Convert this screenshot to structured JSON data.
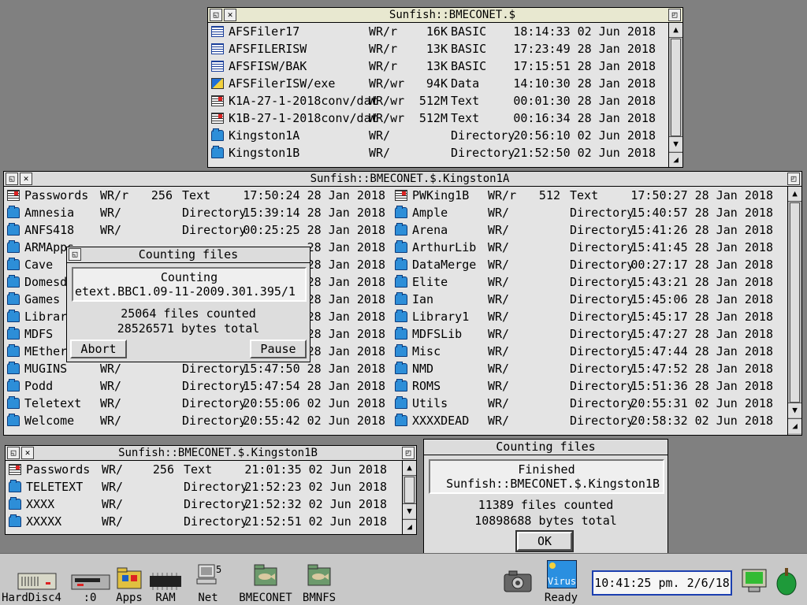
{
  "window_top": {
    "title": "Sunfish::BMECONET.$",
    "rows": [
      {
        "icon": "basic-file-icon",
        "name": "AFSFiler17",
        "access": "WR/r",
        "size": "16K",
        "type": "BASIC",
        "time": "18:14:33 02 Jun 2018"
      },
      {
        "icon": "basic-file-icon",
        "name": "AFSFILERISW",
        "access": "WR/r",
        "size": "13K",
        "type": "BASIC",
        "time": "17:23:49 28 Jan 2018"
      },
      {
        "icon": "basic-file-icon",
        "name": "AFSFISW/BAK",
        "access": "WR/r",
        "size": "13K",
        "type": "BASIC",
        "time": "17:15:51 28 Jan 2018"
      },
      {
        "icon": "data-file-icon",
        "name": "AFSFilerISW/exe",
        "access": "WR/wr",
        "size": "94K",
        "type": "Data",
        "time": "14:10:30 28 Jan 2018"
      },
      {
        "icon": "text-file-icon",
        "name": "K1A-27-1-2018conv/dat",
        "access": "WR/wr",
        "size": "512M",
        "type": "Text",
        "time": "00:01:30 28 Jan 2018"
      },
      {
        "icon": "text-file-icon",
        "name": "K1B-27-1-2018conv/dat",
        "access": "WR/wr",
        "size": "512M",
        "type": "Text",
        "time": "00:16:34 28 Jan 2018"
      },
      {
        "icon": "directory-icon",
        "name": "Kingston1A",
        "access": "WR/",
        "size": "",
        "type": "Directory",
        "time": "20:56:10 02 Jun 2018"
      },
      {
        "icon": "directory-icon",
        "name": "Kingston1B",
        "access": "WR/",
        "size": "",
        "type": "Directory",
        "time": "21:52:50 02 Jun 2018"
      }
    ]
  },
  "window_middle": {
    "title": "Sunfish::BMECONET.$.Kingston1A",
    "left_rows": [
      {
        "icon": "text-file-icon",
        "name": "Passwords",
        "access": "WR/r",
        "size": "256",
        "type": "Text",
        "time": "17:50:24 28 Jan 2018"
      },
      {
        "icon": "directory-icon",
        "name": "Amnesia",
        "access": "WR/",
        "size": "",
        "type": "Directory",
        "time": "15:39:14 28 Jan 2018"
      },
      {
        "icon": "directory-icon",
        "name": "ANFS418",
        "access": "WR/",
        "size": "",
        "type": "Directory",
        "time": "00:25:25 28 Jan 2018"
      },
      {
        "icon": "directory-icon",
        "name": "ARMApps",
        "access": "",
        "size": "",
        "type": "",
        "time": "28 Jan 2018"
      },
      {
        "icon": "directory-icon",
        "name": "Cave",
        "access": "",
        "size": "",
        "type": "",
        "time": "28 Jan 2018"
      },
      {
        "icon": "directory-icon",
        "name": "Domesda",
        "access": "",
        "size": "",
        "type": "",
        "time": "28 Jan 2018"
      },
      {
        "icon": "directory-icon",
        "name": "Games",
        "access": "",
        "size": "",
        "type": "",
        "time": "28 Jan 2018"
      },
      {
        "icon": "directory-icon",
        "name": "Library",
        "access": "",
        "size": "",
        "type": "",
        "time": "28 Jan 2018"
      },
      {
        "icon": "directory-icon",
        "name": "MDFS",
        "access": "",
        "size": "",
        "type": "",
        "time": "28 Jan 2018"
      },
      {
        "icon": "directory-icon",
        "name": "MEthern",
        "access": "",
        "size": "",
        "type": "",
        "time": "28 Jan 2018"
      },
      {
        "icon": "directory-icon",
        "name": "MUGINS",
        "access": "WR/",
        "size": "",
        "type": "Directory",
        "time": "15:47:50 28 Jan 2018"
      },
      {
        "icon": "directory-icon",
        "name": "Podd",
        "access": "WR/",
        "size": "",
        "type": "Directory",
        "time": "15:47:54 28 Jan 2018"
      },
      {
        "icon": "directory-icon",
        "name": "Teletext",
        "access": "WR/",
        "size": "",
        "type": "Directory",
        "time": "20:55:06 02 Jun 2018"
      },
      {
        "icon": "directory-icon",
        "name": "Welcome",
        "access": "WR/",
        "size": "",
        "type": "Directory",
        "time": "20:55:42 02 Jun 2018"
      }
    ],
    "right_rows": [
      {
        "icon": "text-file-icon",
        "name": "PWKing1B",
        "access": "WR/r",
        "size": "512",
        "type": "Text",
        "time": "17:50:27 28 Jan 2018"
      },
      {
        "icon": "directory-icon",
        "name": "Ample",
        "access": "WR/",
        "size": "",
        "type": "Directory",
        "time": "15:40:57 28 Jan 2018"
      },
      {
        "icon": "directory-icon",
        "name": "Arena",
        "access": "WR/",
        "size": "",
        "type": "Directory",
        "time": "15:41:26 28 Jan 2018"
      },
      {
        "icon": "directory-icon",
        "name": "ArthurLib",
        "access": "WR/",
        "size": "",
        "type": "Directory",
        "time": "15:41:45 28 Jan 2018"
      },
      {
        "icon": "directory-icon",
        "name": "DataMerge",
        "access": "WR/",
        "size": "",
        "type": "Directory",
        "time": "00:27:17 28 Jan 2018"
      },
      {
        "icon": "directory-icon",
        "name": "Elite",
        "access": "WR/",
        "size": "",
        "type": "Directory",
        "time": "15:43:21 28 Jan 2018"
      },
      {
        "icon": "directory-icon",
        "name": "Ian",
        "access": "WR/",
        "size": "",
        "type": "Directory",
        "time": "15:45:06 28 Jan 2018"
      },
      {
        "icon": "directory-icon",
        "name": "Library1",
        "access": "WR/",
        "size": "",
        "type": "Directory",
        "time": "15:45:17 28 Jan 2018"
      },
      {
        "icon": "directory-icon",
        "name": "MDFSLib",
        "access": "WR/",
        "size": "",
        "type": "Directory",
        "time": "15:47:27 28 Jan 2018"
      },
      {
        "icon": "directory-icon",
        "name": "Misc",
        "access": "WR/",
        "size": "",
        "type": "Directory",
        "time": "15:47:44 28 Jan 2018"
      },
      {
        "icon": "directory-icon",
        "name": "NMD",
        "access": "WR/",
        "size": "",
        "type": "Directory",
        "time": "15:47:52 28 Jan 2018"
      },
      {
        "icon": "directory-icon",
        "name": "ROMS",
        "access": "WR/",
        "size": "",
        "type": "Directory",
        "time": "15:51:36 28 Jan 2018"
      },
      {
        "icon": "directory-icon",
        "name": "Utils",
        "access": "WR/",
        "size": "",
        "type": "Directory",
        "time": "20:55:31 02 Jun 2018"
      },
      {
        "icon": "directory-icon",
        "name": "XXXXDEAD",
        "access": "WR/",
        "size": "",
        "type": "Directory",
        "time": "20:58:32 02 Jun 2018"
      }
    ]
  },
  "window_bottom": {
    "title": "Sunfish::BMECONET.$.Kingston1B",
    "rows": [
      {
        "icon": "text-file-icon",
        "name": "Passwords",
        "access": "WR/",
        "size": "256",
        "type": "Text",
        "time": "21:01:35 02 Jun 2018"
      },
      {
        "icon": "directory-icon",
        "name": "TELETEXT",
        "access": "WR/",
        "size": "",
        "type": "Directory",
        "time": "21:52:23 02 Jun 2018"
      },
      {
        "icon": "directory-icon",
        "name": "XXXX",
        "access": "WR/",
        "size": "",
        "type": "Directory",
        "time": "21:52:32 02 Jun 2018"
      },
      {
        "icon": "directory-icon",
        "name": "XXXXX",
        "access": "WR/",
        "size": "",
        "type": "Directory",
        "time": "21:52:51 02 Jun 2018"
      }
    ]
  },
  "dialog_counting": {
    "title": "Counting files",
    "status": "Counting",
    "path": "etext.BBC1.09-11-2009.301.395/1",
    "files_counted": "25064 files counted",
    "bytes_total": "28526571 bytes total",
    "abort_label": "Abort",
    "pause_label": "Pause"
  },
  "dialog_finished": {
    "title": "Counting files",
    "status": "Finished",
    "path": "Sunfish::BMECONET.$.Kingston1B",
    "files_counted": "11389 files counted",
    "bytes_total": "10898688 bytes total",
    "ok_label": "OK"
  },
  "iconbar": {
    "items": [
      {
        "name": "harddisc4",
        "label": "HardDisc4",
        "icon": "hard-disc-icon"
      },
      {
        "name": "floppy0",
        "label": ":0",
        "icon": "floppy-drive-icon"
      },
      {
        "name": "apps",
        "label": "Apps",
        "icon": "apps-icon"
      },
      {
        "name": "ram",
        "label": "RAM",
        "icon": "ram-disc-icon"
      },
      {
        "name": "net",
        "label": "Net",
        "icon": "network-icon"
      },
      {
        "name": "bmeconet",
        "label": "BMECONET",
        "icon": "fish-network-icon"
      },
      {
        "name": "bmnfs",
        "label": "BMNFS",
        "icon": "fish-network-icon"
      }
    ],
    "virus_label": "Ready",
    "virus_badge": "Virus",
    "clock": "10:41:25 pm. 2/6/18"
  }
}
